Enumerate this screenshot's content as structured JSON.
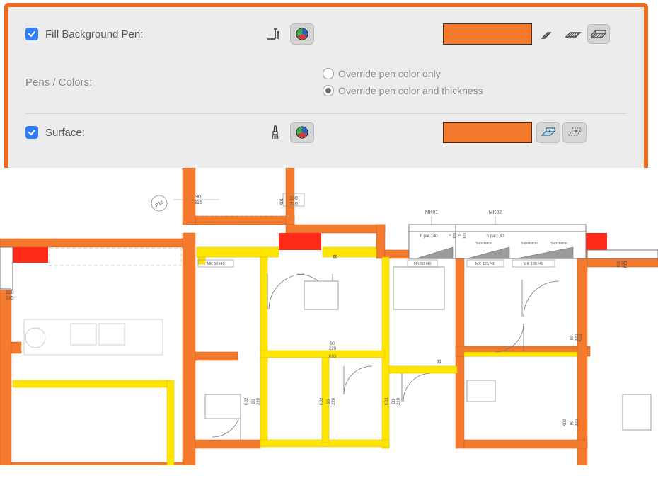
{
  "panel": {
    "fill_bg": {
      "label": "Fill Background Pen:",
      "checked": true,
      "color": "#f47a2d"
    },
    "pens": {
      "label": "Pens / Colors:",
      "radio_a": "Override pen color only",
      "radio_b": "Override pen color and thickness",
      "selected": "b"
    },
    "surface": {
      "label": "Surface:",
      "checked": true,
      "color": "#f47a2d"
    }
  },
  "floorplan": {
    "label_P15": "P15",
    "label_90_315": "90\n315",
    "label_100_220": "100\n220",
    "label_MK01": "MK01",
    "label_MK02": "MK02",
    "label_hpar40_a": "h par.: 40",
    "label_hpar40_b": "h par.: 40",
    "label_substation": "Substation",
    "label_MK50_40_a": "MK 50 /40",
    "label_MK50_40_b": "MK 50 /40",
    "label_MK125_40": "MK 125 /40",
    "label_MK185_40": "MK 185 /40",
    "label_19_170_a": "19\n170",
    "label_19_170_b": "19\n170",
    "label_100_245": "100\n245",
    "label_K01": "K01",
    "label_109_220": "109\n220",
    "label_K03_a": "K03",
    "label_80_220_a": "80\n220",
    "label_80_220_b": "80\n220",
    "label_K03_b": "K03",
    "label_K02": "K02",
    "label_90_220_a": "90\n220",
    "label_90_220_b": "90\n220",
    "label_90_220_c": "90\n220",
    "label_80_220_c": "80\n220",
    "label_K02_b": "K02",
    "label_K02_c": "K02",
    "label_K03_c": "K03"
  }
}
